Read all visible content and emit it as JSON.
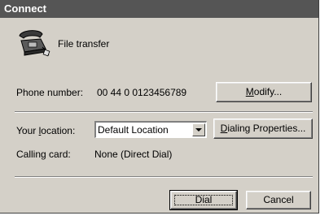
{
  "window": {
    "title": "Connect"
  },
  "connection": {
    "name": "File transfer",
    "icon": "telephone-icon"
  },
  "phone": {
    "label": "Phone number:",
    "value": "00 44 0 0123456789",
    "modify_button": {
      "prefix": "",
      "accel": "M",
      "suffix": "odify..."
    }
  },
  "location": {
    "label_prefix": "Your ",
    "label_accel": "l",
    "label_suffix": "ocation:",
    "selected": "Default Location",
    "dialing_properties_button": {
      "prefix": "",
      "accel": "D",
      "suffix": "ialing Properties..."
    }
  },
  "calling_card": {
    "label": "Calling card:",
    "value": "None (Direct Dial)"
  },
  "buttons": {
    "dial": "Dial",
    "cancel": "Cancel"
  },
  "colors": {
    "dialog_face": "#d4d0c8",
    "title_bar": "#555555"
  }
}
